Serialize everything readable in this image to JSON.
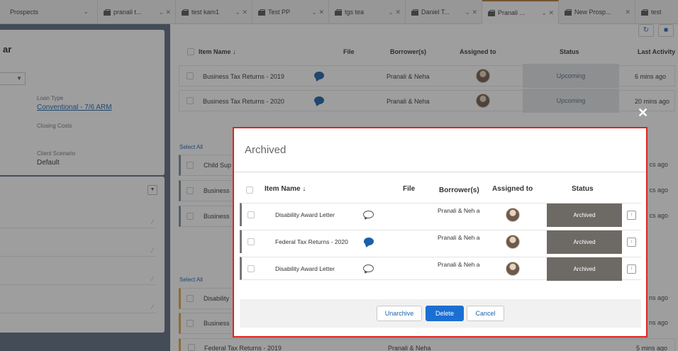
{
  "tabs": [
    {
      "label": "Prospects",
      "icon": "home-icon"
    },
    {
      "label": "pranali t...",
      "icon": "home-icon"
    },
    {
      "label": "test kam1",
      "icon": "home-icon"
    },
    {
      "label": "Test PP",
      "icon": "home-icon"
    },
    {
      "label": "tgs tea",
      "icon": "home-icon"
    },
    {
      "label": "Daniel T...",
      "icon": "home-icon"
    },
    {
      "label": "Pranali ...",
      "icon": "home-icon"
    },
    {
      "label": "New Prosp...",
      "icon": "home-icon"
    },
    {
      "label": "test",
      "icon": "home-icon"
    }
  ],
  "left_panel": {
    "title_fragment": "ar",
    "loan_type_label": "Loan Type",
    "loan_type_value": "Conventional - 7/6 ARM",
    "closing_costs_label": "Closing Costs",
    "client_scenario_label": "Client Scenario",
    "client_scenario_value": "Default"
  },
  "background_table": {
    "headers": {
      "item_name": "Item Name ↓",
      "file": "File",
      "borrowers": "Borrower(s)",
      "assigned_to": "Assigned to",
      "status": "Status",
      "last_activity": "Last Activity"
    },
    "rows": [
      {
        "name": "Business Tax Returns - 2019",
        "borrower": "Pranali & Neha",
        "status": "Upcoming",
        "last_activity": "6 mins ago"
      },
      {
        "name": "Business Tax Returns - 2020",
        "borrower": "Pranali & Neha",
        "status": "Upcoming",
        "last_activity": "20 mins ago"
      }
    ],
    "select_all": "Select All",
    "group1": [
      {
        "name": "Child Sup",
        "time": "cs ago"
      },
      {
        "name": "Business",
        "time": "cs ago"
      },
      {
        "name": "Business",
        "time": "cs ago"
      }
    ],
    "group2": [
      {
        "name": "Disability",
        "time": "ns ago"
      },
      {
        "name": "Business",
        "time": "ns ago"
      }
    ],
    "partial_bottom_row": {
      "name": "Federal Tax Returns - 2019",
      "borrower": "Pranali & Neha",
      "time": "5 mins ago"
    }
  },
  "modal": {
    "title": "Archived",
    "headers": {
      "item_name": "Item Name ↓",
      "file": "File",
      "borrowers": "Borrower(s)",
      "assigned_to": "Assigned to",
      "status": "Status"
    },
    "rows": [
      {
        "name": "Disability Award Letter",
        "borrower": "Pranali & Neh a",
        "status": "Archived",
        "comment_icon": "comment-outline-icon"
      },
      {
        "name": "Federal Tax Returns - 2020",
        "borrower": "Pranali & Neh a",
        "status": "Archived",
        "comment_icon": "comment-filled-icon"
      },
      {
        "name": "Disability Award Letter",
        "borrower": "Pranali & Neh a",
        "status": "Archived",
        "comment_icon": "comment-outline-icon"
      }
    ],
    "buttons": {
      "unarchive": "Unarchive",
      "delete": "Delete",
      "cancel": "Cancel"
    },
    "close_symbol": "✕"
  },
  "colors": {
    "accent_blue": "#1b6fd2",
    "archived_gray": "#6d6a66",
    "highlight_red": "#e3231f"
  }
}
